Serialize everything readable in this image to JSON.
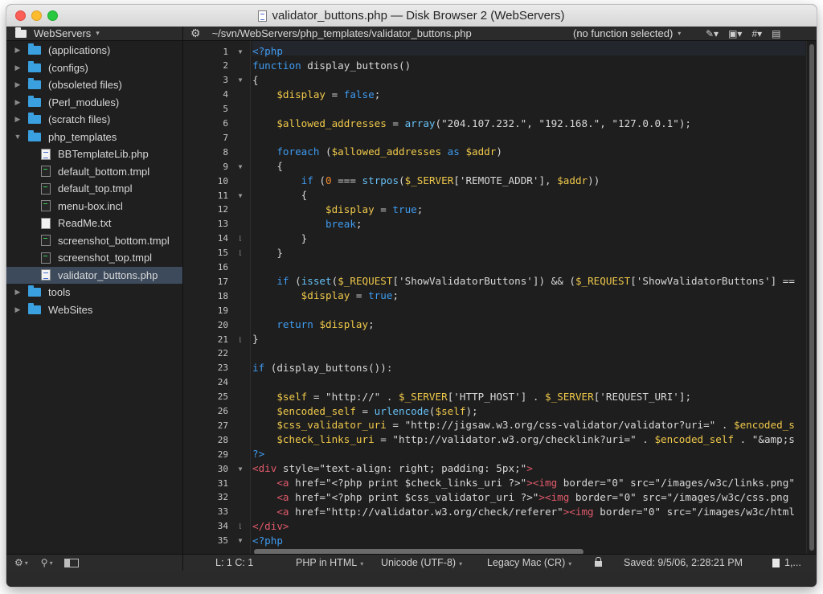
{
  "window": {
    "title": "validator_buttons.php — Disk Browser 2 (WebServers)"
  },
  "sidebar": {
    "root": "WebServers",
    "items": [
      {
        "label": "(applications)",
        "type": "folder",
        "depth": 0,
        "expanded": false
      },
      {
        "label": "(configs)",
        "type": "folder",
        "depth": 0,
        "expanded": false
      },
      {
        "label": "(obsoleted files)",
        "type": "folder",
        "depth": 0,
        "expanded": false
      },
      {
        "label": "(Perl_modules)",
        "type": "folder",
        "depth": 0,
        "expanded": false
      },
      {
        "label": "(scratch files)",
        "type": "folder",
        "depth": 0,
        "expanded": false
      },
      {
        "label": "php_templates",
        "type": "folder",
        "depth": 0,
        "expanded": true
      },
      {
        "label": "BBTemplateLib.php",
        "type": "php",
        "depth": 1
      },
      {
        "label": "default_bottom.tmpl",
        "type": "tmpl",
        "depth": 1
      },
      {
        "label": "default_top.tmpl",
        "type": "tmpl",
        "depth": 1
      },
      {
        "label": "menu-box.incl",
        "type": "tmpl",
        "depth": 1
      },
      {
        "label": "ReadMe.txt",
        "type": "txt",
        "depth": 1
      },
      {
        "label": "screenshot_bottom.tmpl",
        "type": "tmpl",
        "depth": 1
      },
      {
        "label": "screenshot_top.tmpl",
        "type": "tmpl",
        "depth": 1
      },
      {
        "label": "validator_buttons.php",
        "type": "php",
        "depth": 1,
        "selected": true
      },
      {
        "label": "tools",
        "type": "folder",
        "depth": 0,
        "expanded": false
      },
      {
        "label": "WebSites",
        "type": "folder",
        "depth": 0,
        "expanded": false
      }
    ]
  },
  "navbar": {
    "path": "~/svn/WebServers/php_templates/validator_buttons.php",
    "function": "(no function selected)"
  },
  "editor": {
    "lines": [
      {
        "n": 1,
        "fold": "open",
        "tokens": [
          [
            "p",
            "<?php"
          ]
        ]
      },
      {
        "n": 2,
        "fold": "",
        "tokens": [
          [
            "k",
            "function"
          ],
          [
            "b",
            " display_buttons()"
          ]
        ]
      },
      {
        "n": 3,
        "fold": "open",
        "tokens": [
          [
            "b",
            "{"
          ]
        ]
      },
      {
        "n": 4,
        "fold": "",
        "tokens": [
          [
            "b",
            "    "
          ],
          [
            "v",
            "$display"
          ],
          [
            "b",
            " = "
          ],
          [
            "k",
            "false"
          ],
          [
            "b",
            ";"
          ]
        ]
      },
      {
        "n": 5,
        "fold": "",
        "tokens": []
      },
      {
        "n": 6,
        "fold": "",
        "tokens": [
          [
            "b",
            "    "
          ],
          [
            "v",
            "$allowed_addresses"
          ],
          [
            "b",
            " = "
          ],
          [
            "f",
            "array"
          ],
          [
            "b",
            "("
          ],
          [
            "s",
            "\"204.107.232.\""
          ],
          [
            "b",
            ", "
          ],
          [
            "s",
            "\"192.168.\""
          ],
          [
            "b",
            ", "
          ],
          [
            "s",
            "\"127.0.0.1\""
          ],
          [
            "b",
            ");"
          ]
        ]
      },
      {
        "n": 7,
        "fold": "",
        "tokens": []
      },
      {
        "n": 8,
        "fold": "",
        "tokens": [
          [
            "b",
            "    "
          ],
          [
            "k",
            "foreach"
          ],
          [
            "b",
            " ("
          ],
          [
            "v",
            "$allowed_addresses"
          ],
          [
            "b",
            " "
          ],
          [
            "k",
            "as"
          ],
          [
            "b",
            " "
          ],
          [
            "v",
            "$addr"
          ],
          [
            "b",
            ")"
          ]
        ]
      },
      {
        "n": 9,
        "fold": "open",
        "tokens": [
          [
            "b",
            "    {"
          ]
        ]
      },
      {
        "n": 10,
        "fold": "",
        "tokens": [
          [
            "b",
            "        "
          ],
          [
            "k",
            "if"
          ],
          [
            "b",
            " ("
          ],
          [
            "n",
            "0"
          ],
          [
            "b",
            " === "
          ],
          [
            "f",
            "strpos"
          ],
          [
            "b",
            "("
          ],
          [
            "v",
            "$_SERVER"
          ],
          [
            "b",
            "["
          ],
          [
            "s",
            "'REMOTE_ADDR'"
          ],
          [
            "b",
            "], "
          ],
          [
            "v",
            "$addr"
          ],
          [
            "b",
            "))"
          ]
        ]
      },
      {
        "n": 11,
        "fold": "open",
        "tokens": [
          [
            "b",
            "        {"
          ]
        ]
      },
      {
        "n": 12,
        "fold": "",
        "tokens": [
          [
            "b",
            "            "
          ],
          [
            "v",
            "$display"
          ],
          [
            "b",
            " = "
          ],
          [
            "k",
            "true"
          ],
          [
            "b",
            ";"
          ]
        ]
      },
      {
        "n": 13,
        "fold": "",
        "tokens": [
          [
            "b",
            "            "
          ],
          [
            "k",
            "break"
          ],
          [
            "b",
            ";"
          ]
        ]
      },
      {
        "n": 14,
        "fold": "close",
        "tokens": [
          [
            "b",
            "        }"
          ]
        ]
      },
      {
        "n": 15,
        "fold": "close",
        "tokens": [
          [
            "b",
            "    }"
          ]
        ]
      },
      {
        "n": 16,
        "fold": "",
        "tokens": []
      },
      {
        "n": 17,
        "fold": "",
        "tokens": [
          [
            "b",
            "    "
          ],
          [
            "k",
            "if"
          ],
          [
            "b",
            " ("
          ],
          [
            "f",
            "isset"
          ],
          [
            "b",
            "("
          ],
          [
            "v",
            "$_REQUEST"
          ],
          [
            "b",
            "["
          ],
          [
            "s",
            "'ShowValidatorButtons'"
          ],
          [
            "b",
            "]) && ("
          ],
          [
            "v",
            "$_REQUEST"
          ],
          [
            "b",
            "["
          ],
          [
            "s",
            "'ShowValidatorButtons'"
          ],
          [
            "b",
            "] =="
          ]
        ]
      },
      {
        "n": 18,
        "fold": "",
        "tokens": [
          [
            "b",
            "        "
          ],
          [
            "v",
            "$display"
          ],
          [
            "b",
            " = "
          ],
          [
            "k",
            "true"
          ],
          [
            "b",
            ";"
          ]
        ]
      },
      {
        "n": 19,
        "fold": "",
        "tokens": []
      },
      {
        "n": 20,
        "fold": "",
        "tokens": [
          [
            "b",
            "    "
          ],
          [
            "k",
            "return"
          ],
          [
            "b",
            " "
          ],
          [
            "v",
            "$display"
          ],
          [
            "b",
            ";"
          ]
        ]
      },
      {
        "n": 21,
        "fold": "close",
        "tokens": [
          [
            "b",
            "}"
          ]
        ]
      },
      {
        "n": 22,
        "fold": "",
        "tokens": []
      },
      {
        "n": 23,
        "fold": "",
        "tokens": [
          [
            "k",
            "if"
          ],
          [
            "b",
            " (display_buttons()):"
          ]
        ]
      },
      {
        "n": 24,
        "fold": "",
        "tokens": []
      },
      {
        "n": 25,
        "fold": "",
        "tokens": [
          [
            "b",
            "    "
          ],
          [
            "v",
            "$self"
          ],
          [
            "b",
            " = "
          ],
          [
            "s",
            "\"http://\""
          ],
          [
            "b",
            " . "
          ],
          [
            "v",
            "$_SERVER"
          ],
          [
            "b",
            "["
          ],
          [
            "s",
            "'HTTP_HOST'"
          ],
          [
            "b",
            "] . "
          ],
          [
            "v",
            "$_SERVER"
          ],
          [
            "b",
            "["
          ],
          [
            "s",
            "'REQUEST_URI'"
          ],
          [
            "b",
            "];"
          ]
        ]
      },
      {
        "n": 26,
        "fold": "",
        "tokens": [
          [
            "b",
            "    "
          ],
          [
            "v",
            "$encoded_self"
          ],
          [
            "b",
            " = "
          ],
          [
            "f",
            "urlencode"
          ],
          [
            "b",
            "("
          ],
          [
            "v",
            "$self"
          ],
          [
            "b",
            ");"
          ]
        ]
      },
      {
        "n": 27,
        "fold": "",
        "tokens": [
          [
            "b",
            "    "
          ],
          [
            "v",
            "$css_validator_uri"
          ],
          [
            "b",
            " = "
          ],
          [
            "s",
            "\"http://jigsaw.w3.org/css-validator/validator?uri=\""
          ],
          [
            "b",
            " . "
          ],
          [
            "v",
            "$encoded_s"
          ]
        ]
      },
      {
        "n": 28,
        "fold": "",
        "tokens": [
          [
            "b",
            "    "
          ],
          [
            "v",
            "$check_links_uri"
          ],
          [
            "b",
            " = "
          ],
          [
            "s",
            "\"http://validator.w3.org/checklink?uri=\""
          ],
          [
            "b",
            " . "
          ],
          [
            "v",
            "$encoded_self"
          ],
          [
            "b",
            " . "
          ],
          [
            "s",
            "\"&amp;s"
          ]
        ]
      },
      {
        "n": 29,
        "fold": "",
        "tokens": [
          [
            "p",
            "?>"
          ]
        ]
      },
      {
        "n": 30,
        "fold": "open",
        "tokens": [
          [
            "t",
            "<div"
          ],
          [
            "a",
            " style="
          ],
          [
            "s",
            "\"text-align: right; padding: 5px;\""
          ],
          [
            "t",
            ">"
          ]
        ]
      },
      {
        "n": 31,
        "fold": "",
        "tokens": [
          [
            "b",
            "    "
          ],
          [
            "t",
            "<a"
          ],
          [
            "a",
            " href="
          ],
          [
            "s",
            "\"<?php print $check_links_uri ?>\""
          ],
          [
            "t",
            ">"
          ],
          [
            "t",
            "<img"
          ],
          [
            "a",
            " border="
          ],
          [
            "s",
            "\"0\""
          ],
          [
            "a",
            " src="
          ],
          [
            "s",
            "\"/images/w3c/links.png\""
          ]
        ]
      },
      {
        "n": 32,
        "fold": "",
        "tokens": [
          [
            "b",
            "    "
          ],
          [
            "t",
            "<a"
          ],
          [
            "a",
            " href="
          ],
          [
            "s",
            "\"<?php print $css_validator_uri ?>\""
          ],
          [
            "t",
            ">"
          ],
          [
            "t",
            "<img"
          ],
          [
            "a",
            " border="
          ],
          [
            "s",
            "\"0\""
          ],
          [
            "a",
            " src="
          ],
          [
            "s",
            "\"/images/w3c/css.png"
          ]
        ]
      },
      {
        "n": 33,
        "fold": "",
        "tokens": [
          [
            "b",
            "    "
          ],
          [
            "t",
            "<a"
          ],
          [
            "a",
            " href="
          ],
          [
            "s",
            "\"http://validator.w3.org/check/referer\""
          ],
          [
            "t",
            ">"
          ],
          [
            "t",
            "<img"
          ],
          [
            "a",
            " border="
          ],
          [
            "s",
            "\"0\""
          ],
          [
            "a",
            " src="
          ],
          [
            "s",
            "\"/images/w3c/html"
          ]
        ]
      },
      {
        "n": 34,
        "fold": "close",
        "tokens": [
          [
            "t",
            "</div>"
          ]
        ]
      },
      {
        "n": 35,
        "fold": "open",
        "tokens": [
          [
            "p",
            "<?php"
          ]
        ]
      }
    ]
  },
  "status": {
    "position": "L: 1 C: 1",
    "language": "PHP in HTML",
    "encoding": "Unicode (UTF-8)",
    "line_endings": "Legacy Mac (CR)",
    "saved": "Saved: 9/5/06, 2:28:21 PM",
    "doc_stats": "1,..."
  },
  "colors": {
    "keyword": "#3f9bf0",
    "variable": "#f0c94a",
    "string": "#d8d8d8",
    "number": "#f28b30",
    "function": "#67c0f5",
    "tag": "#e05a6a",
    "selection": "#3d4a5c",
    "folder": "#3aa0e0"
  }
}
